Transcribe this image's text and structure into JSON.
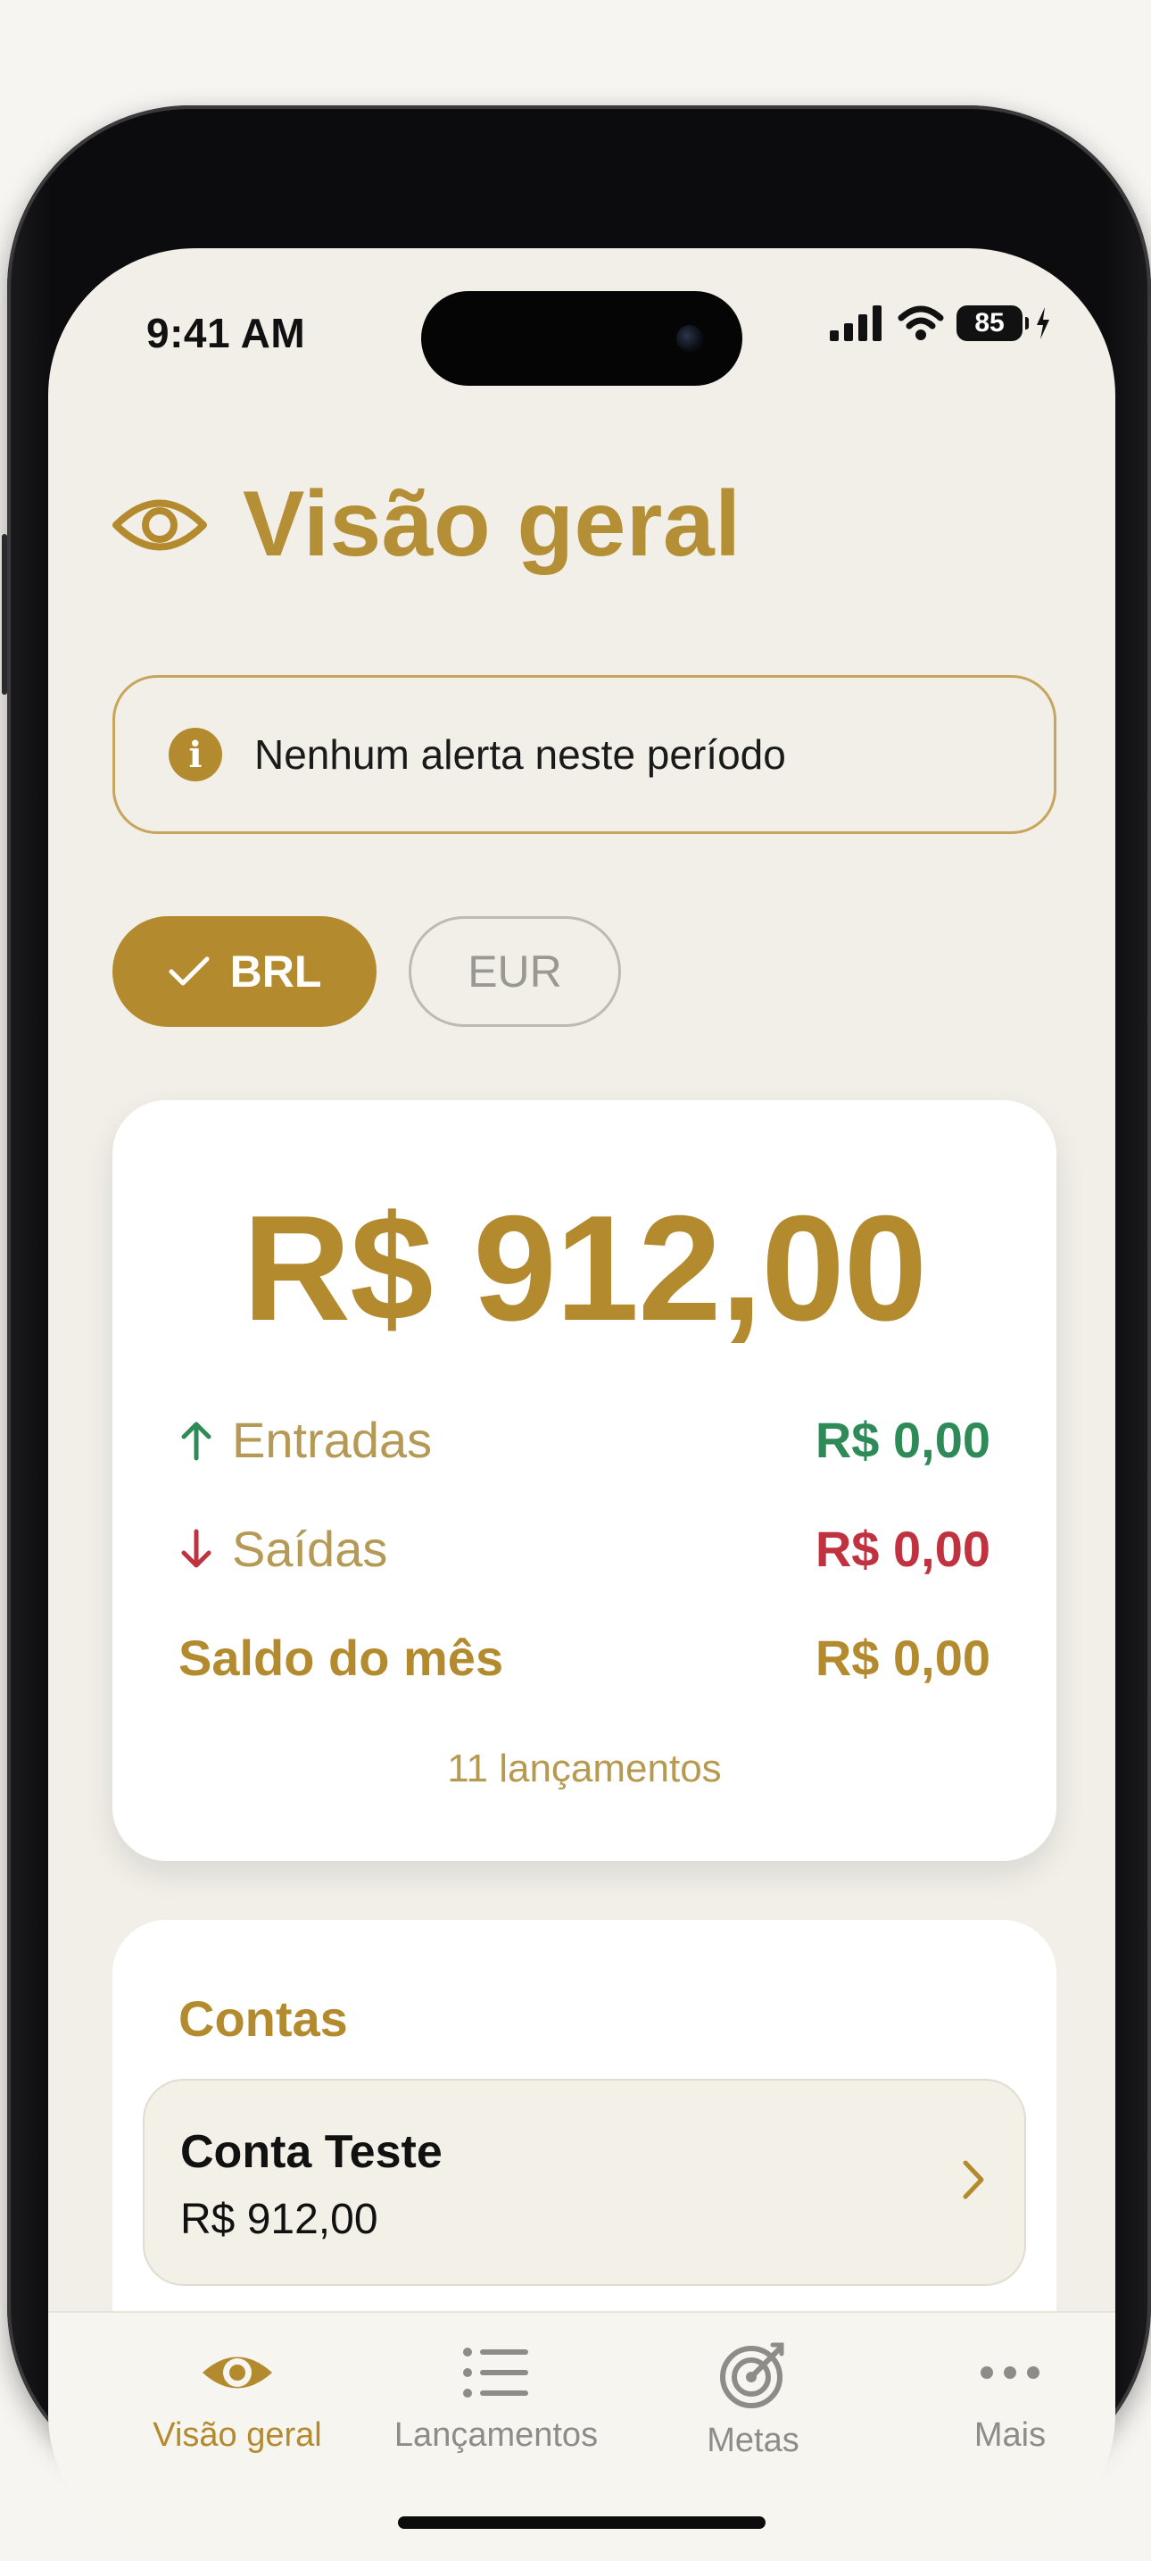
{
  "status_bar": {
    "time": "9:41 AM",
    "battery": "85"
  },
  "header": {
    "title": "Visão geral"
  },
  "alert": {
    "text": "Nenhum alerta neste período"
  },
  "currencies": [
    {
      "label": "BRL",
      "selected": true
    },
    {
      "label": "EUR",
      "selected": false
    }
  ],
  "summary": {
    "balance": "R$ 912,00",
    "income_label": "Entradas",
    "income_value": "R$ 0,00",
    "expense_label": "Saídas",
    "expense_value": "R$ 0,00",
    "month_balance_label": "Saldo do mês",
    "month_balance_value": "R$ 0,00",
    "entries_count": "11 lançamentos"
  },
  "accounts": {
    "title": "Contas",
    "items": [
      {
        "name": "Conta Teste",
        "balance": "R$ 912,00"
      }
    ]
  },
  "tabs": [
    {
      "label": "Visão geral",
      "icon": "eye-icon",
      "active": true
    },
    {
      "label": "Lançamentos",
      "icon": "list-icon",
      "active": false
    },
    {
      "label": "Metas",
      "icon": "target-icon",
      "active": false
    },
    {
      "label": "Mais",
      "icon": "more-icon",
      "active": false
    }
  ],
  "colors": {
    "accent": "#b38b2e",
    "income": "#2e8b57",
    "expense": "#c0323f",
    "background": "#f1efe8"
  }
}
